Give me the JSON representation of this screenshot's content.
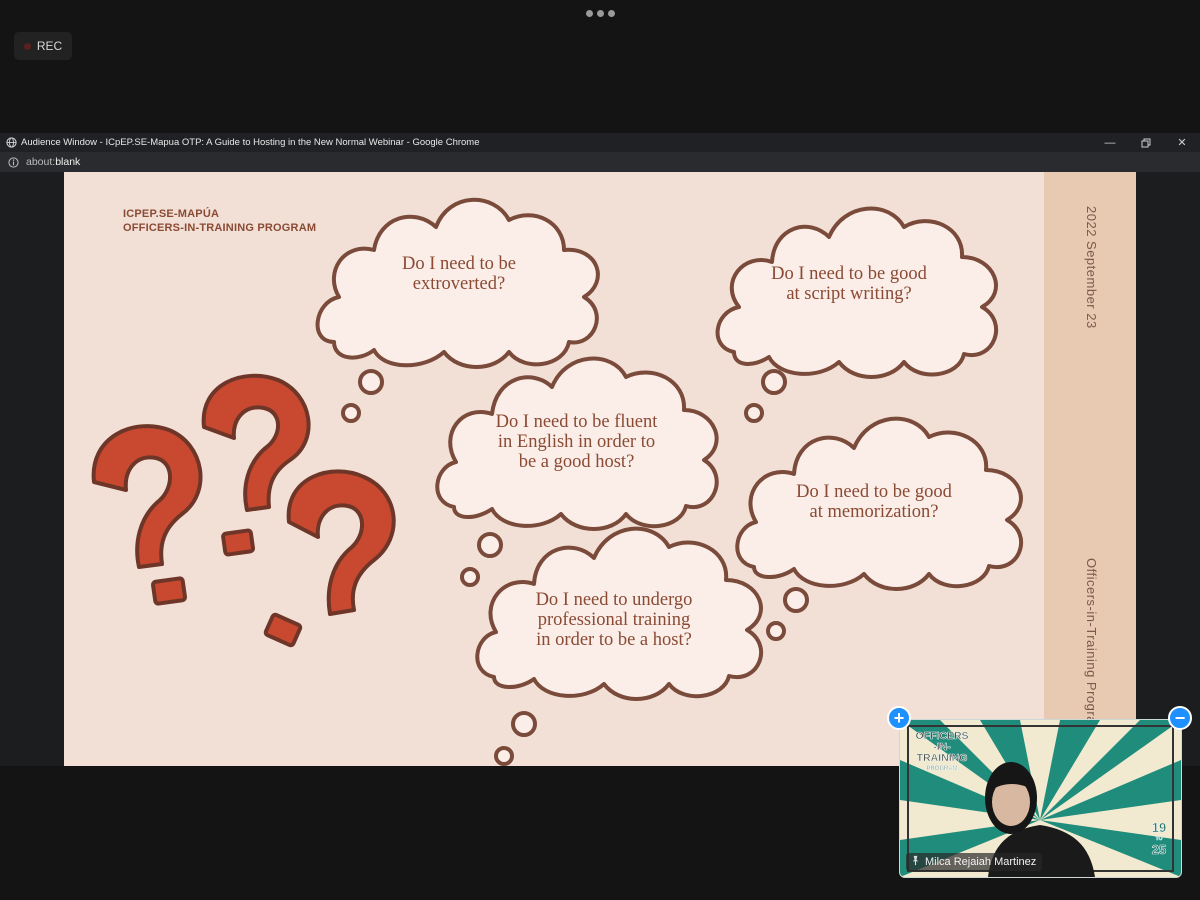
{
  "recording": {
    "label": "REC"
  },
  "browser": {
    "window_title": "Audience Window - ICpEP.SE-Mapua OTP: A Guide to Hosting in the New Normal Webinar - Google Chrome",
    "url_scheme": "about:",
    "url_rest": "blank",
    "icons": [
      "globe-icon",
      "info-icon",
      "minimize-icon",
      "restore-icon",
      "close-icon"
    ]
  },
  "slide": {
    "org_line1": "ICPEP.SE-MAPÚA",
    "org_line2": "OFFICERS-IN-TRAINING PROGRAM",
    "side_date": "2022 September 23",
    "side_program": "Officers-in-Training Progra",
    "questions": [
      {
        "l1": "Do I need to be",
        "l2": "extroverted?",
        "l3": ""
      },
      {
        "l1": "Do I need to be good",
        "l2": "at script writing?",
        "l3": ""
      },
      {
        "l1": "Do I need to be fluent",
        "l2": "in English in order to",
        "l3": "be a good host?"
      },
      {
        "l1": "Do I need to be good",
        "l2": "at memorization?",
        "l3": ""
      },
      {
        "l1": "Do I need to undergo",
        "l2": "professional training",
        "l3": "in order to be a host?"
      }
    ],
    "colors": {
      "bg": "#f2e0d6",
      "band": "#e8c9b1",
      "text": "#8b4a34",
      "outline": "#7a4a3a",
      "question_mark": "#c8492f"
    }
  },
  "video": {
    "participant_name": "Milca Rejaiah Martinez",
    "bg_logo_line1": "OFFICERS",
    "bg_logo_line2": "-IN-",
    "bg_logo_line3": "TRAINING",
    "bg_logo_line4": "PROGRAM",
    "bg_num_top": "19",
    "bg_num_mid": "TO",
    "bg_num_bot": "25",
    "pin_icon": "pin-icon",
    "add_button": "+",
    "remove_button": "−"
  }
}
